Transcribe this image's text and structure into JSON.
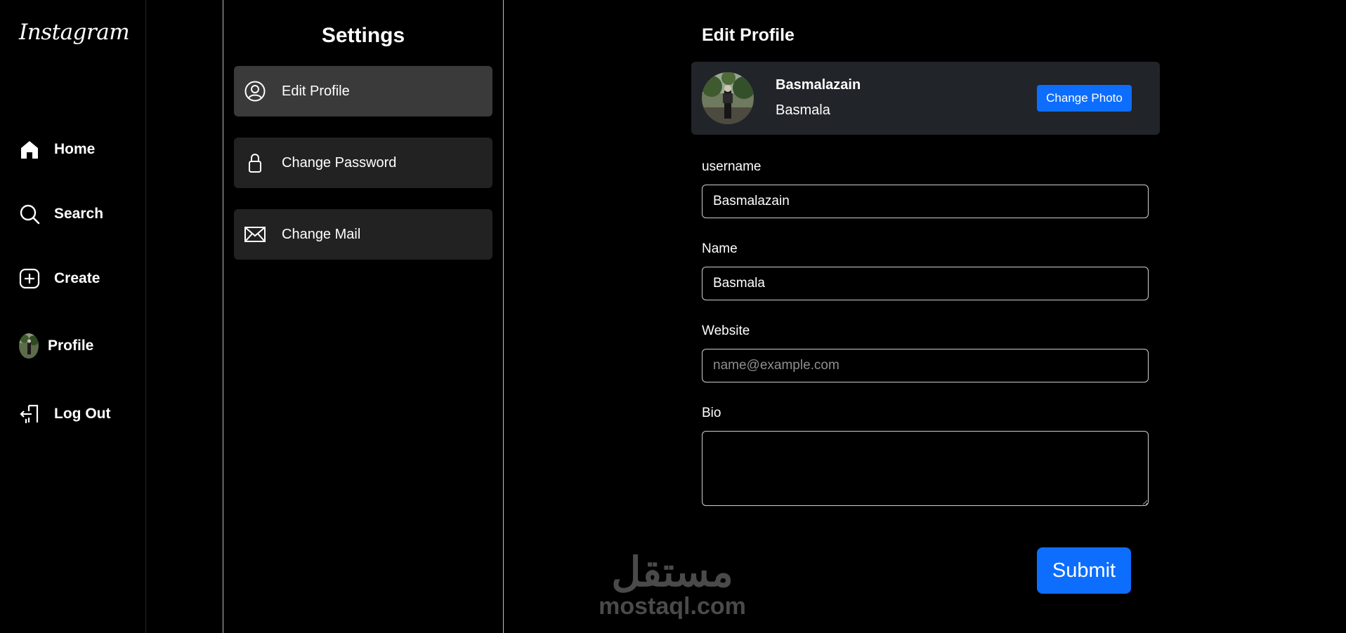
{
  "nav": {
    "logo": "Instagram",
    "items": [
      {
        "label": "Home",
        "icon": "home-icon"
      },
      {
        "label": "Search",
        "icon": "search-icon"
      },
      {
        "label": "Create",
        "icon": "plus-square-icon"
      },
      {
        "label": "Profile",
        "icon": "avatar"
      },
      {
        "label": "Log Out",
        "icon": "logout-icon"
      }
    ]
  },
  "settings": {
    "title": "Settings",
    "items": [
      {
        "label": "Edit Profile",
        "icon": "user-circle-icon",
        "active": true
      },
      {
        "label": "Change Password",
        "icon": "lock-icon",
        "active": false
      },
      {
        "label": "Change Mail",
        "icon": "envelope-icon",
        "active": false
      }
    ]
  },
  "main": {
    "title": "Edit Profile",
    "card": {
      "username": "Basmalazain",
      "name": "Basmala",
      "change_photo_label": "Change Photo"
    },
    "fields": {
      "username": {
        "label": "username",
        "value": "Basmalazain"
      },
      "name": {
        "label": "Name",
        "value": "Basmala"
      },
      "website": {
        "label": "Website",
        "value": "",
        "placeholder": "name@example.com"
      },
      "bio": {
        "label": "Bio",
        "value": ""
      }
    },
    "submit_label": "Submit"
  },
  "watermark": {
    "arabic": "مستقل",
    "latin": "mostaql.com"
  },
  "colors": {
    "accent": "#0d6efd",
    "background": "#000000",
    "card": "#212428",
    "settings_item": "#222222",
    "settings_item_active": "#3a3a3a"
  }
}
